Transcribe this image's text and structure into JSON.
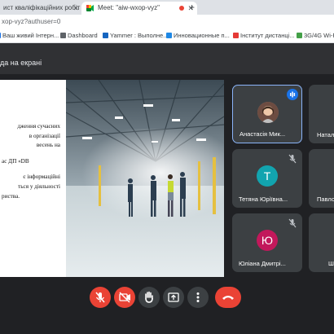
{
  "browser": {
    "tabs": [
      {
        "label": "ист кваліфікаційних робіт М",
        "active": false
      },
      {
        "label": "Meet: \"aiw-wxop-vyz\"",
        "active": true
      }
    ],
    "address": "xop-vyz?authuser=0",
    "bookmarks": [
      {
        "label": "Ваш живий Інтерн...",
        "color": "#1a73e8"
      },
      {
        "label": "Dashboard",
        "color": "#5f6368"
      },
      {
        "label": "Yammer : Выполне...",
        "color": "#1565c0"
      },
      {
        "label": "Инновационные п...",
        "color": "#1e88e5"
      },
      {
        "label": "Інститут дистанці...",
        "color": "#e53935"
      },
      {
        "label": "3G/4G Wi-Fi",
        "color": "#43a047"
      }
    ]
  },
  "meet": {
    "presentation_label": "да на екрані",
    "slide_lines": [
      "дження сучасних",
      "в  організації",
      "весень         на",
      "",
      "ас ДП «DB",
      "",
      "є    інформаційні",
      "ться у діяльності",
      "риства."
    ],
    "participants": [
      {
        "name": "Анастасія Мик...",
        "initial": "",
        "avatar_color": "#8d6e63",
        "speaking": true,
        "muted": false,
        "photo": true
      },
      {
        "name": "Натал",
        "initial": "",
        "avatar_color": "#3c4043",
        "speaking": false,
        "muted": false,
        "photo": false
      },
      {
        "name": "Тетяна Юріївна...",
        "initial": "Т",
        "avatar_color": "#12a4af",
        "speaking": false,
        "muted": true,
        "photo": false
      },
      {
        "name": "Павло",
        "initial": "",
        "avatar_color": "#3c4043",
        "speaking": false,
        "muted": false,
        "photo": false
      },
      {
        "name": "Юліана Дмитрі...",
        "initial": "Ю",
        "avatar_color": "#c2185b",
        "speaking": false,
        "muted": true,
        "photo": false
      },
      {
        "name": "Ш",
        "initial": "",
        "avatar_color": "#3c4043",
        "speaking": false,
        "muted": false,
        "photo": false
      }
    ],
    "controls": [
      {
        "name": "mic-toggle-button",
        "icon": "mic-off-icon",
        "color": "#ea4335"
      },
      {
        "name": "camera-toggle-button",
        "icon": "camera-off-icon",
        "color": "#ea4335"
      },
      {
        "name": "raise-hand-button",
        "icon": "hand-icon",
        "color": "#3c4043"
      },
      {
        "name": "present-button",
        "icon": "present-icon",
        "color": "#3c4043"
      },
      {
        "name": "more-options-button",
        "icon": "more-vert-icon",
        "color": "#3c4043"
      },
      {
        "name": "leave-call-button",
        "icon": "phone-hangup-icon",
        "color": "#ea4335"
      }
    ]
  }
}
